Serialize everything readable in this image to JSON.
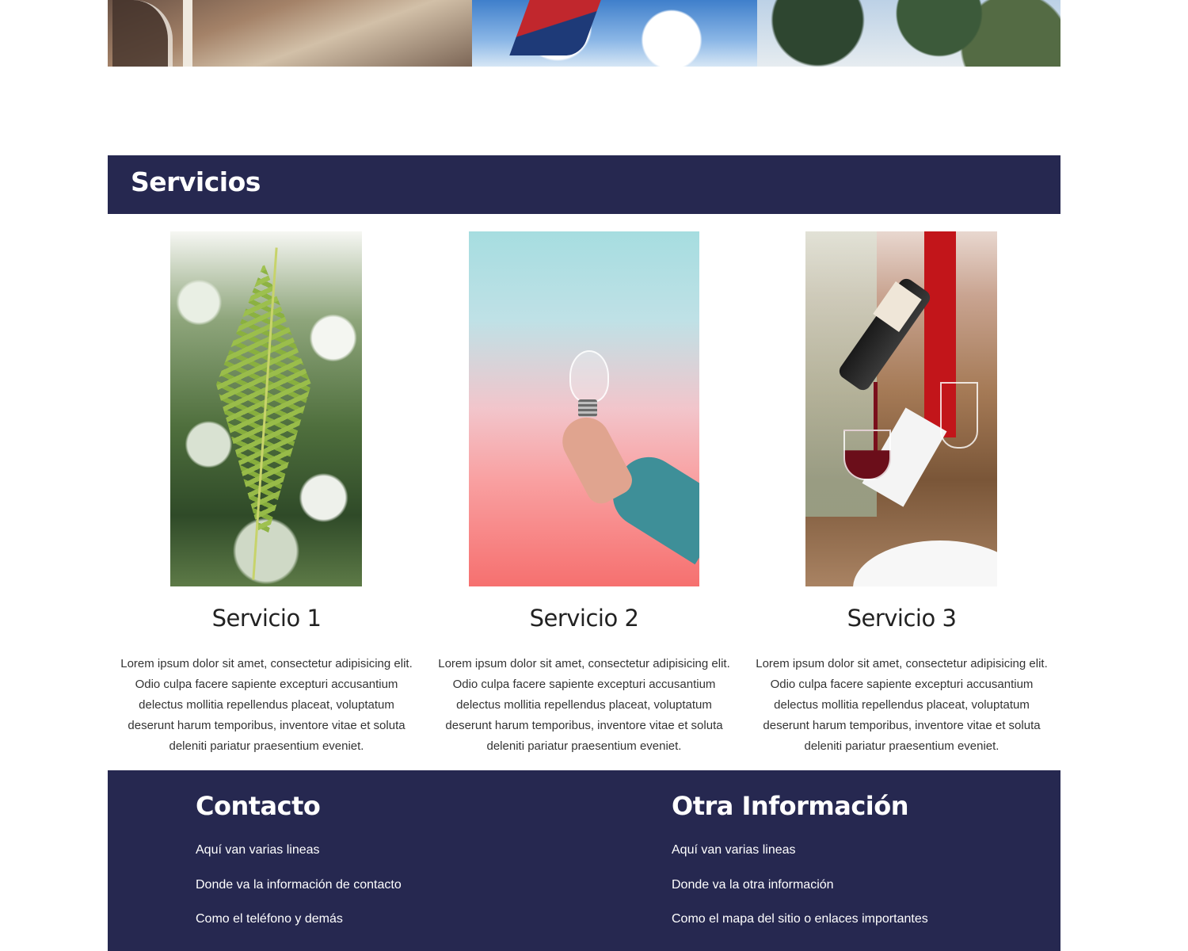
{
  "services": {
    "heading": "Servicios",
    "items": [
      {
        "title": "Servicio 1",
        "text": "Lorem ipsum dolor sit amet, consectetur adipisicing elit. Odio culpa facere sapiente excepturi accusantium delectus mollitia repellendus placeat, voluptatum deserunt harum temporibus, inventore vitae et soluta deleniti pariatur praesentium eveniet."
      },
      {
        "title": "Servicio 2",
        "text": "Lorem ipsum dolor sit amet, consectetur adipisicing elit. Odio culpa facere sapiente excepturi accusantium delectus mollitia repellendus placeat, voluptatum deserunt harum temporibus, inventore vitae et soluta deleniti pariatur praesentium eveniet."
      },
      {
        "title": "Servicio 3",
        "text": "Lorem ipsum dolor sit amet, consectetur adipisicing elit. Odio culpa facere sapiente excepturi accusantium delectus mollitia repellendus placeat, voluptatum deserunt harum temporibus, inventore vitae et soluta deleniti pariatur praesentium eveniet."
      }
    ]
  },
  "footer": {
    "contact": {
      "title": "Contacto",
      "lines": [
        "Aquí van varias lineas",
        "Donde va la información de contacto",
        "Como el teléfono y demás"
      ]
    },
    "other": {
      "title": "Otra Información",
      "lines": [
        "Aquí van varias lineas",
        "Donde va la otra información",
        "Como el mapa del sitio o enlaces importantes"
      ]
    }
  },
  "colors": {
    "navy": "#262850",
    "text": "#333333",
    "white": "#ffffff"
  }
}
